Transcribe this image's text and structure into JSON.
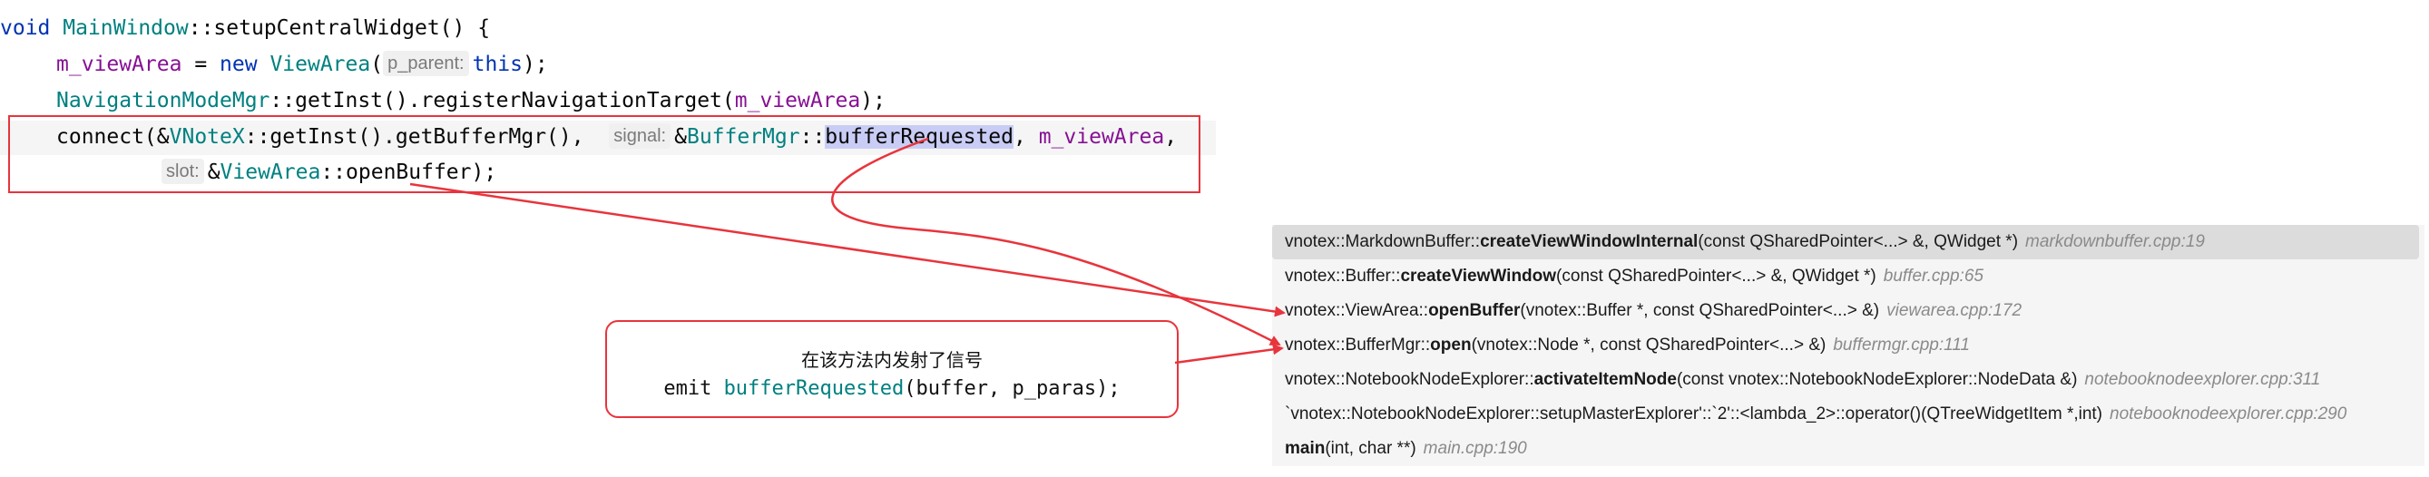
{
  "code": {
    "line1": {
      "kw": "void",
      "cls": "MainWindow",
      "rest": "::setupCentralWidget() {"
    },
    "line2": {
      "field": "m_viewArea",
      "eq": " = ",
      "kw": "new",
      "cls": "ViewArea",
      "open": "(",
      "hint": "p_parent:",
      "kw2": "this",
      "close": ");"
    },
    "line3": {
      "cls": "NavigationModeMgr",
      "mid": "::getInst().registerNavigationTarget(",
      "field": "m_viewArea",
      "close": ");"
    },
    "line4": {
      "pre": "connect(&",
      "cls": "VNoteX",
      "mid": "::getInst().getBufferMgr(),",
      "hint": "signal:",
      "amp": "&",
      "cls2": "BufferMgr",
      "sep": "::",
      "sel": "bufferRequested",
      "comma": ", ",
      "field": "m_viewArea",
      "end": ","
    },
    "line5": {
      "hint": "slot:",
      "amp": "&",
      "cls": "ViewArea",
      "rest": "::openBuffer);"
    }
  },
  "callstack": [
    {
      "prefix": "vnotex::MarkdownBuffer::",
      "fn": "createViewWindowInternal",
      "args": "(const QSharedPointer<...> &, QWidget *)",
      "loc": "markdownbuffer.cpp:19"
    },
    {
      "prefix": "vnotex::Buffer::",
      "fn": "createViewWindow",
      "args": "(const QSharedPointer<...> &, QWidget *)",
      "loc": "buffer.cpp:65"
    },
    {
      "prefix": "vnotex::ViewArea::",
      "fn": "openBuffer",
      "args": "(vnotex::Buffer *, const QSharedPointer<...> &)",
      "loc": "viewarea.cpp:172"
    },
    {
      "prefix": "vnotex::BufferMgr::",
      "fn": "open",
      "args": "(vnotex::Node *, const QSharedPointer<...> &)",
      "loc": "buffermgr.cpp:111"
    },
    {
      "prefix": "vnotex::NotebookNodeExplorer::",
      "fn": "activateItemNode",
      "args": "(const vnotex::NotebookNodeExplorer::NodeData &)",
      "loc": "notebooknodeexplorer.cpp:311"
    },
    {
      "prefix": "",
      "fn": "",
      "args": "`vnotex::NotebookNodeExplorer::setupMasterExplorer'::`2'::<lambda_2>::operator()(QTreeWidgetItem *,int)",
      "loc": "notebooknodeexplorer.cpp:290"
    },
    {
      "prefix": "",
      "fn": "main",
      "args": "(int, char **)",
      "loc": "main.cpp:190"
    }
  ],
  "annotation": {
    "title": "在该方法内发射了信号",
    "emit_kw": "emit ",
    "emit_cls": "bufferRequested",
    "emit_rest": "(buffer, p_paras);"
  },
  "colors": {
    "annotation_red": "#e8343c",
    "keyword": "#0033b3",
    "class": "#008080",
    "field": "#871094"
  }
}
